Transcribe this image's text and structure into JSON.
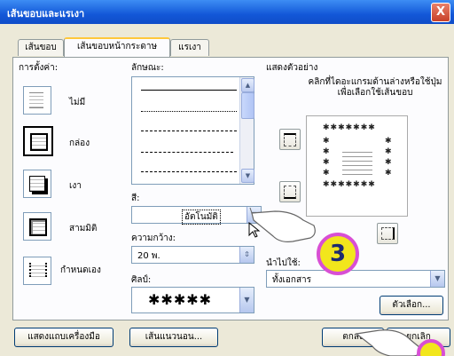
{
  "window": {
    "title": "เส้นขอบและแรเงา",
    "close": "X"
  },
  "tabs": [
    {
      "label": "เส้นขอบ"
    },
    {
      "label": "เส้นขอบหน้ากระดาษ"
    },
    {
      "label": "แรเงา"
    }
  ],
  "setting": {
    "title": "การตั้งค่า:",
    "presets": [
      {
        "label": "ไม่มี"
      },
      {
        "label": "กล่อง"
      },
      {
        "label": "เงา"
      },
      {
        "label": "สามมิติ"
      },
      {
        "label": "กำหนดเอง"
      }
    ]
  },
  "style": {
    "title": "ลักษณะ:",
    "color_label": "สี:",
    "color_value": "อัตโนมัติ",
    "width_label": "ความกว้าง:",
    "width_value": "20 พ.",
    "art_label": "ศิลป์:",
    "art_value": "✱✱✱✱✱"
  },
  "preview": {
    "title": "แสดงตัวอย่าง",
    "hint": "คลิกที่ไดอะแกรมด้านล่างหรือใช้ปุ่มเพื่อเลือกใช้เส้นขอบ",
    "apply_label": "นำไปใช้:",
    "apply_value": "ทั้งเอกสาร",
    "options_button": "ตัวเลือก..."
  },
  "footer": {
    "toolbar_button": "แสดงแถบเครื่องมือ",
    "hline_button": "เส้นแนวนอน...",
    "ok_button": "ตกลง",
    "cancel_button": "ยกเลิก"
  },
  "callout": "3"
}
